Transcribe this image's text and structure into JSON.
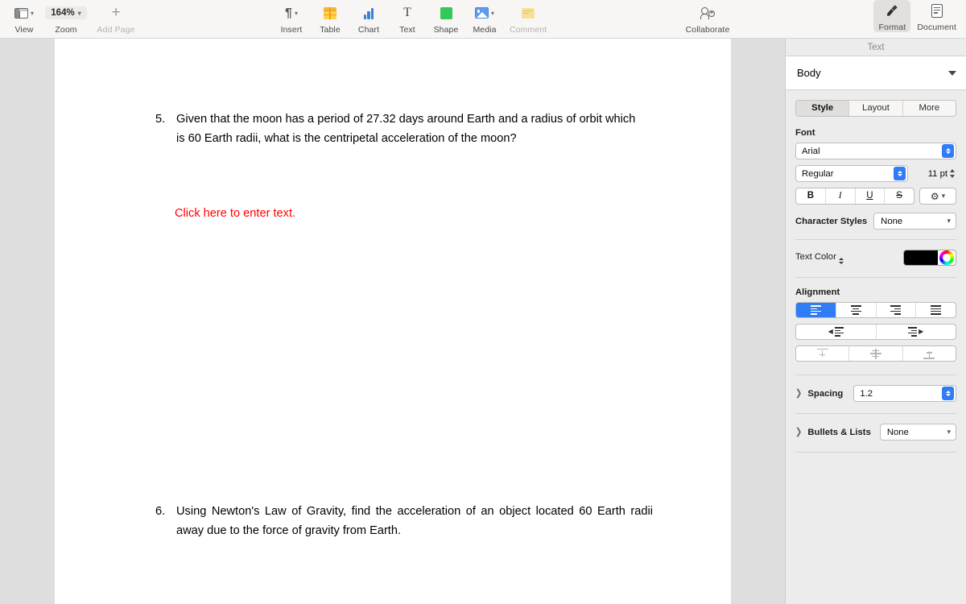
{
  "toolbar": {
    "view": {
      "label": "View",
      "icon": "view-layout-icon"
    },
    "zoom": {
      "label": "Zoom",
      "value": "164%"
    },
    "add_page": {
      "label": "Add Page",
      "icon": "plus-icon",
      "disabled": true
    },
    "insert": {
      "label": "Insert",
      "icon": "pilcrow-icon"
    },
    "table": {
      "label": "Table",
      "icon": "table-icon"
    },
    "chart": {
      "label": "Chart",
      "icon": "bar-chart-icon"
    },
    "text": {
      "label": "Text",
      "icon": "text-t-icon"
    },
    "shape": {
      "label": "Shape",
      "icon": "green-square-icon"
    },
    "media": {
      "label": "Media",
      "icon": "photo-icon"
    },
    "comment": {
      "label": "Comment",
      "icon": "comment-icon",
      "disabled": true
    },
    "collaborate": {
      "label": "Collaborate",
      "icon": "person-add-icon"
    },
    "format": {
      "label": "Format",
      "icon": "paintbrush-icon",
      "active": true
    },
    "document": {
      "label": "Document",
      "icon": "document-icon",
      "active": false
    }
  },
  "document_body": {
    "questions": [
      {
        "number": "5.",
        "line1": "Given that the moon has a period of 27.32 days around Earth and a radius of orbit which",
        "line2": "is 60 Earth radii, what is the centripetal acceleration of the moon?"
      },
      {
        "number": "6.",
        "line1": "Using Newton's Law of Gravity, find the acceleration of an object located 60 Earth radii",
        "line2": "away due to the force of gravity from Earth."
      }
    ],
    "placeholder_field": {
      "text": "Click here to enter text.",
      "color": "#ff0000"
    }
  },
  "panel": {
    "header": "Text",
    "paragraph_style": "Body",
    "tabs": [
      {
        "label": "Style",
        "selected": true
      },
      {
        "label": "Layout",
        "selected": false
      },
      {
        "label": "More",
        "selected": false
      }
    ],
    "font": {
      "title": "Font",
      "family": "Arial",
      "weight": "Regular",
      "size": "11 pt",
      "styles": [
        {
          "name": "bold",
          "label": "B"
        },
        {
          "name": "italic",
          "label": "I"
        },
        {
          "name": "underline",
          "label": "U"
        },
        {
          "name": "strikethrough",
          "label": "S"
        }
      ],
      "advanced_label": "⚙",
      "character_styles_label": "Character Styles",
      "character_styles_value": "None"
    },
    "text_color": {
      "label": "Text Color",
      "swatch": "#000000"
    },
    "alignment": {
      "title": "Alignment",
      "horizontal": [
        {
          "name": "align-left",
          "selected": true
        },
        {
          "name": "align-center",
          "selected": false
        },
        {
          "name": "align-right",
          "selected": false
        },
        {
          "name": "align-justify",
          "selected": false
        }
      ],
      "indent": [
        {
          "name": "decrease-indent"
        },
        {
          "name": "increase-indent"
        }
      ],
      "vertical": [
        {
          "name": "align-top",
          "disabled": true
        },
        {
          "name": "align-middle",
          "disabled": true
        },
        {
          "name": "align-bottom",
          "disabled": true
        }
      ]
    },
    "spacing": {
      "label": "Spacing",
      "value": "1.2"
    },
    "bullets": {
      "label": "Bullets & Lists",
      "value": "None"
    }
  }
}
